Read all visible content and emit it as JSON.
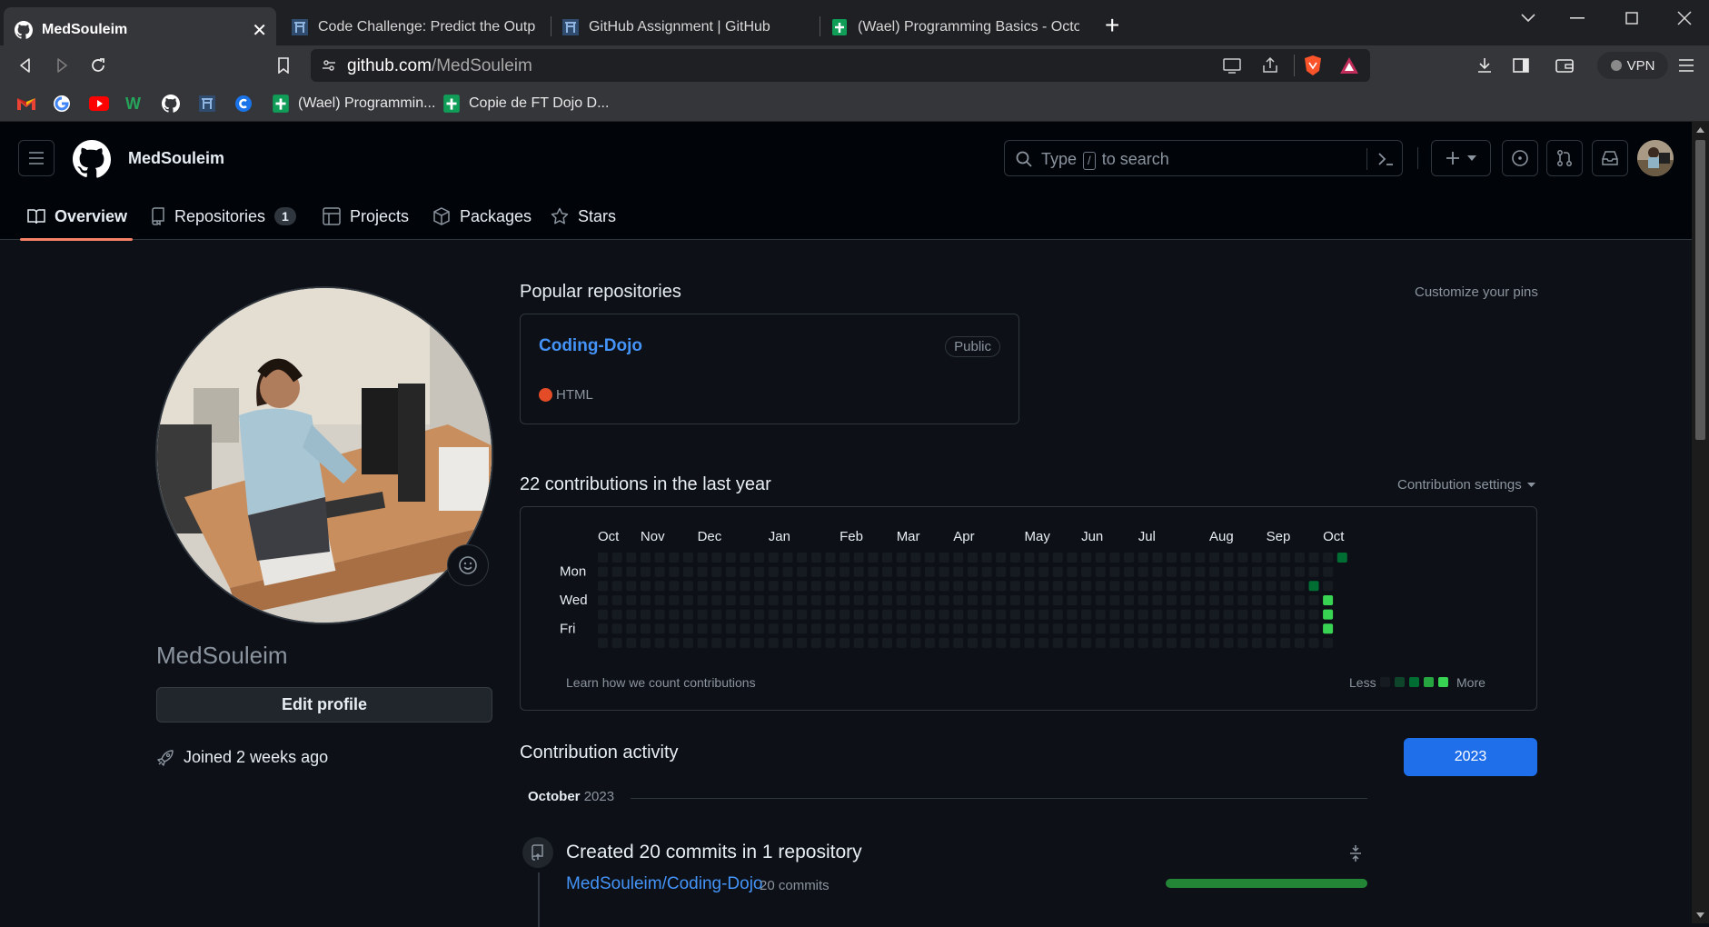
{
  "browser": {
    "tabs": [
      {
        "title": "MedSouleim",
        "icon": "github-icon",
        "active": true
      },
      {
        "title": "Code Challenge: Predict the Output | L",
        "icon": "coding-dojo-icon"
      },
      {
        "title": "GitHub Assignment | GitHub",
        "icon": "coding-dojo-icon"
      },
      {
        "title": "(Wael) Programming Basics - October",
        "icon": "google-sheets-icon"
      }
    ],
    "url_host": "github.com",
    "url_path": "/MedSouleim",
    "vpn_label": "VPN",
    "bookmarks": [
      {
        "label": "",
        "icon": "gmail-icon"
      },
      {
        "label": "",
        "icon": "google-icon"
      },
      {
        "label": "",
        "icon": "youtube-icon"
      },
      {
        "label": "",
        "icon": "w-icon"
      },
      {
        "label": "",
        "icon": "github-icon"
      },
      {
        "label": "",
        "icon": "coding-dojo-icon"
      },
      {
        "label": "",
        "icon": "c-icon"
      },
      {
        "label": "(Wael) Programmin...",
        "icon": "google-sheets-icon"
      },
      {
        "label": "Copie de FT Dojo D...",
        "icon": "google-sheets-icon"
      }
    ]
  },
  "header": {
    "username": "MedSouleim",
    "search_prefix": "Type",
    "search_key": "/",
    "search_suffix": "to search"
  },
  "nav": {
    "tabs": [
      {
        "label": "Overview",
        "icon": "book-icon",
        "selected": true
      },
      {
        "label": "Repositories",
        "icon": "repo-icon",
        "count": "1"
      },
      {
        "label": "Projects",
        "icon": "table-icon"
      },
      {
        "label": "Packages",
        "icon": "package-icon"
      },
      {
        "label": "Stars",
        "icon": "star-icon"
      }
    ]
  },
  "profile": {
    "username": "MedSouleim",
    "edit_label": "Edit profile",
    "joined": "Joined 2 weeks ago"
  },
  "popular": {
    "title": "Popular repositories",
    "customize": "Customize your pins",
    "repo": {
      "name": "Coding-Dojo",
      "visibility": "Public",
      "language": "HTML",
      "language_color": "#e34c26"
    }
  },
  "contributions": {
    "title": "22 contributions in the last year",
    "settings": "Contribution settings",
    "months": [
      "Oct",
      "Nov",
      "Dec",
      "Jan",
      "Feb",
      "Mar",
      "Apr",
      "May",
      "Jun",
      "Jul",
      "Aug",
      "Sep",
      "Oct"
    ],
    "days": [
      "Mon",
      "Wed",
      "Fri"
    ],
    "learn": "Learn how we count contributions",
    "less": "Less",
    "more": "More",
    "weeks": 53,
    "active_cells": [
      {
        "week": 52,
        "day": 0,
        "level": 2
      },
      {
        "week": 50,
        "day": 2,
        "level": 2
      },
      {
        "week": 51,
        "day": 3,
        "level": 4
      },
      {
        "week": 51,
        "day": 4,
        "level": 4
      },
      {
        "week": 51,
        "day": 5,
        "level": 4
      }
    ],
    "colors": [
      "#161b22",
      "#0e4429",
      "#006d32",
      "#26a641",
      "#39d353"
    ]
  },
  "activity": {
    "title": "Contribution activity",
    "year": "2023",
    "month": "October",
    "month_year": "2023",
    "summary": "Created 20 commits in 1 repository",
    "repo": "MedSouleim/Coding-Dojo",
    "commits": "20 commits"
  }
}
